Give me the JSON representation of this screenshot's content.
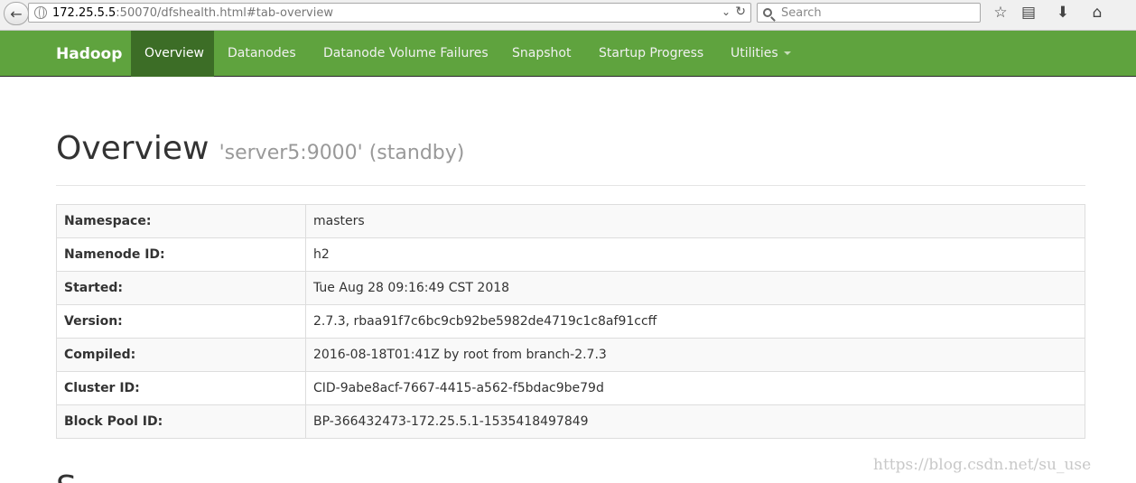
{
  "browser": {
    "url_host": "172.25.5.5",
    "url_rest": ":50070/dfshealth.html#tab-overview",
    "search_placeholder": "Search"
  },
  "navbar": {
    "brand": "Hadoop",
    "items": [
      {
        "label": "Overview"
      },
      {
        "label": "Datanodes"
      },
      {
        "label": "Datanode Volume Failures"
      },
      {
        "label": "Snapshot"
      },
      {
        "label": "Startup Progress"
      },
      {
        "label": "Utilities"
      }
    ]
  },
  "overview": {
    "title": "Overview",
    "subtitle": "'server5:9000' (standby)",
    "rows": [
      {
        "label": "Namespace:",
        "value": "masters"
      },
      {
        "label": "Namenode ID:",
        "value": "h2"
      },
      {
        "label": "Started:",
        "value": "Tue Aug 28 09:16:49 CST 2018"
      },
      {
        "label": "Version:",
        "value": "2.7.3, rbaa91f7c6bc9cb92be5982de4719c1c8af91ccff"
      },
      {
        "label": "Compiled:",
        "value": "2016-08-18T01:41Z by root from branch-2.7.3"
      },
      {
        "label": "Cluster ID:",
        "value": "CID-9abe8acf-7667-4415-a562-f5bdac9be79d"
      },
      {
        "label": "Block Pool ID:",
        "value": "BP-366432473-172.25.5.1-1535418497849"
      }
    ]
  },
  "next_heading": "S",
  "watermark": "https://blog.csdn.net/su_use"
}
